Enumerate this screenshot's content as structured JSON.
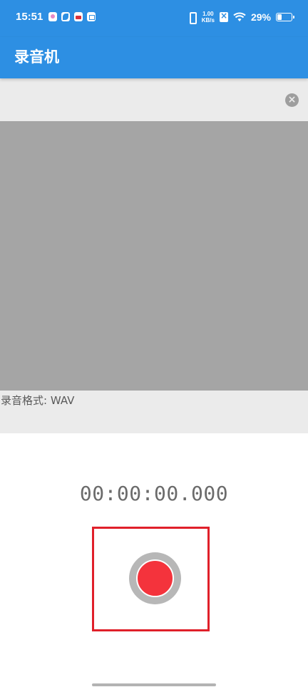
{
  "status_bar": {
    "time": "15:51",
    "netspeed_value": "1.00",
    "netspeed_unit": "KB/s",
    "battery_percent": "29%",
    "battery_level": 0.29,
    "notification_icons": [
      "gallery-icon",
      "leaf-app-icon",
      "video-app-icon",
      "store-icon"
    ]
  },
  "app_bar": {
    "title": "录音机"
  },
  "banner": {
    "close_icon": "close-icon"
  },
  "recording": {
    "format_label": "录音格式: WAV",
    "timer": "00:00:00.000"
  },
  "colors": {
    "accent": "#2d8fe3",
    "record": "#f4333c",
    "highlight": "#e0202a"
  }
}
